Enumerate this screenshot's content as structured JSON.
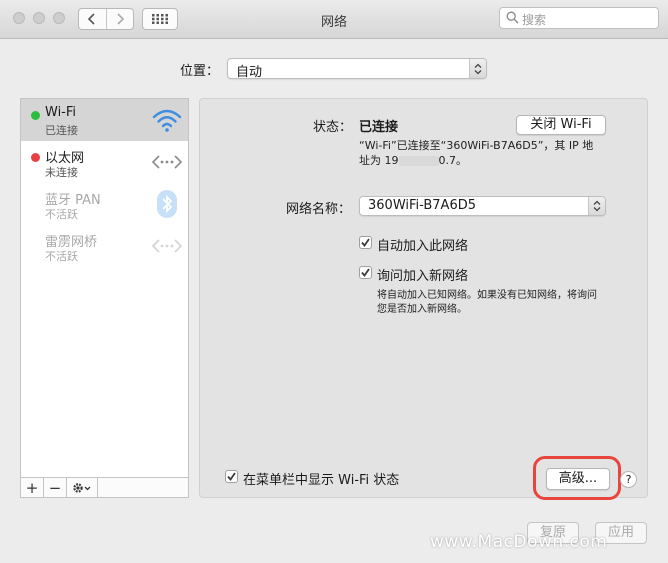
{
  "window": {
    "title": "网络"
  },
  "search": {
    "placeholder": "搜索"
  },
  "location": {
    "label": "位置：",
    "value": "自动"
  },
  "services": [
    {
      "name": "Wi-Fi",
      "status": "已连接",
      "dot": "#2bbd3d",
      "icon": "wifi-icon"
    },
    {
      "name": "以太网",
      "status": "未连接",
      "dot": "#e84040",
      "icon": "ethernet-icon"
    },
    {
      "name": "蓝牙 PAN",
      "status": "不活跃",
      "icon": "bluetooth-icon"
    },
    {
      "name": "雷雳网桥",
      "status": "不活跃",
      "icon": "thunderbolt-bridge-icon"
    }
  ],
  "sidebar_tools": {
    "add": "+",
    "remove": "−",
    "gear": "gear-icon"
  },
  "detail": {
    "status_label": "状态：",
    "status_value": "已连接",
    "turn_off_button": "关闭 Wi-Fi",
    "status_desc_line1": "“Wi-Fi”已连接至“360WiFi-B7A6D5”，其 IP 地",
    "status_desc_line2_prefix": "址为 19",
    "status_desc_line2_suffix": "0.7。",
    "network_name_label": "网络名称：",
    "network_name_value": "360WiFi-B7A6D5",
    "auto_join_label": "自动加入此网络",
    "ask_join_label": "询问加入新网络",
    "ask_desc_line1": "将自动加入已知网络。如果没有已知网络，将询问",
    "ask_desc_line2": "您是否加入新网络。",
    "show_menubar_label": "在菜单栏中显示 Wi-Fi 状态",
    "advanced_button": "高级...",
    "help_button": "?"
  },
  "footer": {
    "revert_button": "复原",
    "apply_button": "应用"
  },
  "watermark": "www.MacDown.com",
  "colors": {
    "highlight": "#e8453c",
    "selected_row": "#d5d5d5",
    "check_mark": "#3a3a3a"
  }
}
